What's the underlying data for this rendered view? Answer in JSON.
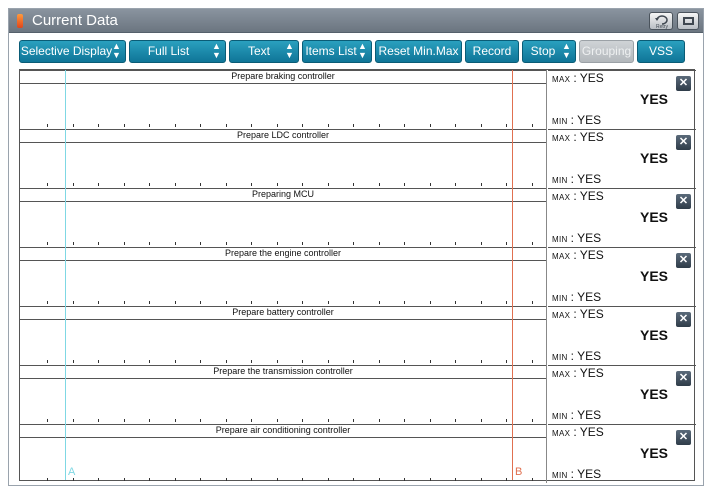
{
  "window": {
    "title": "Current Data"
  },
  "titlebar_buttons": [
    {
      "name": "retry",
      "label": "Retry"
    },
    {
      "name": "restore"
    }
  ],
  "toolbar": {
    "buttons": [
      {
        "label": "Selective Display",
        "dropdown": true
      },
      {
        "label": "Full List",
        "dropdown": true
      },
      {
        "label": "Text",
        "dropdown": true
      },
      {
        "label": "Items List",
        "dropdown": true
      },
      {
        "label": "Reset Min.Max",
        "dropdown": false
      },
      {
        "label": "Record",
        "dropdown": false
      },
      {
        "label": "Stop",
        "dropdown": true
      },
      {
        "label": "Grouping",
        "dropdown": false,
        "disabled": true
      },
      {
        "label": "VSS",
        "dropdown": false
      }
    ]
  },
  "panels": [
    {
      "title": "Prepare braking controller",
      "max_label": "MAX",
      "max_value": "YES",
      "current": "YES",
      "min_label": "MIN",
      "min_value": "YES"
    },
    {
      "title": "Prepare LDC controller",
      "max_label": "MAX",
      "max_value": "YES",
      "current": "YES",
      "min_label": "MIN",
      "min_value": "YES"
    },
    {
      "title": "Preparing MCU",
      "max_label": "MAX",
      "max_value": "YES",
      "current": "YES",
      "min_label": "MIN",
      "min_value": "YES"
    },
    {
      "title": "Prepare the engine controller",
      "max_label": "MAX",
      "max_value": "YES",
      "current": "YES",
      "min_label": "MIN",
      "min_value": "YES"
    },
    {
      "title": "Prepare battery controller",
      "max_label": "MAX",
      "max_value": "YES",
      "current": "YES",
      "min_label": "MIN",
      "min_value": "YES"
    },
    {
      "title": "Prepare the transmission controller",
      "max_label": "MAX",
      "max_value": "YES",
      "current": "YES",
      "min_label": "MIN",
      "min_value": "YES"
    },
    {
      "title": "Prepare air conditioning controller",
      "max_label": "MAX",
      "max_value": "YES",
      "current": "YES",
      "min_label": "MIN",
      "min_value": "YES"
    }
  ],
  "cursors": {
    "a_label": "A",
    "b_label": "B"
  },
  "colors": {
    "button": "#1a8bad",
    "cursor_a": "#7fd8e4",
    "cursor_b": "#e07050",
    "title_icon": "#e0451b"
  }
}
